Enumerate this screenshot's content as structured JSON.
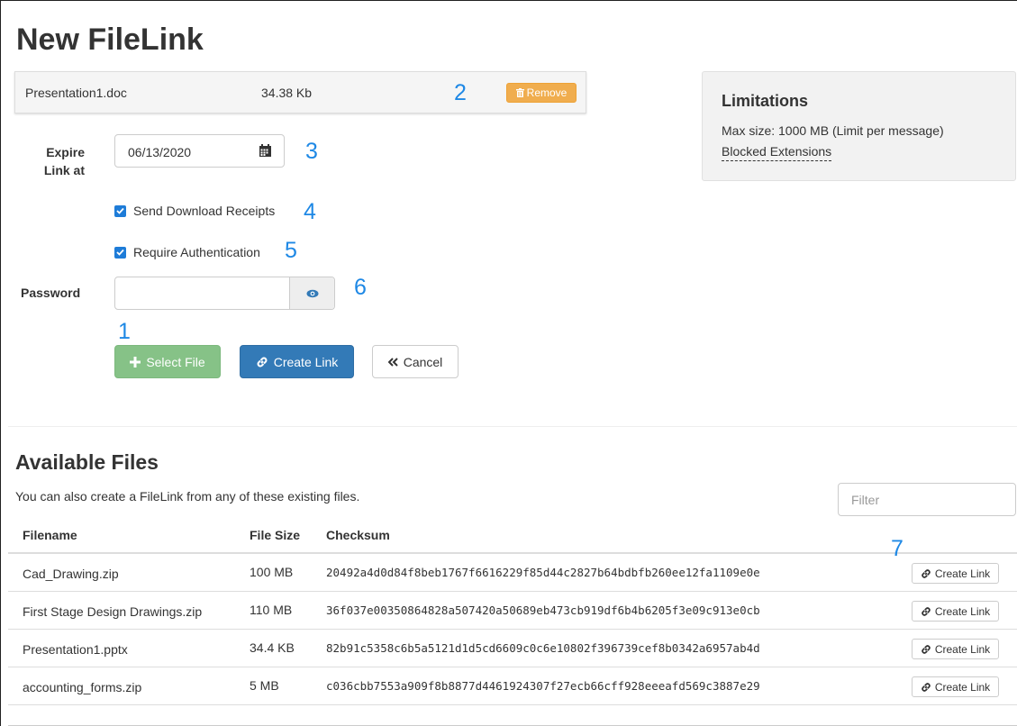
{
  "page": {
    "title": "New FileLink"
  },
  "upload": {
    "filename": "Presentation1.doc",
    "size": "34.38 Kb",
    "remove_label": "Remove"
  },
  "limitations": {
    "title": "Limitations",
    "max_size": "Max size: 1000 MB (Limit per message)",
    "blocked_link": "Blocked Extensions"
  },
  "form": {
    "expire_label_line1": "Expire",
    "expire_label_line2": "Link at",
    "expire_value": "06/13/2020",
    "send_receipts_label": "Send Download Receipts",
    "send_receipts_checked": true,
    "require_auth_label": "Require Authentication",
    "require_auth_checked": true,
    "password_label": "Password",
    "password_value": ""
  },
  "buttons": {
    "select_file": "Select File",
    "create_link": "Create Link",
    "cancel": "Cancel"
  },
  "annotations": {
    "n1": "1",
    "n2": "2",
    "n3": "3",
    "n4": "4",
    "n5": "5",
    "n6": "6",
    "n7": "7"
  },
  "available": {
    "title": "Available Files",
    "subtitle": "You can also create a FileLink from any of these existing files.",
    "filter_placeholder": "Filter",
    "columns": {
      "filename": "Filename",
      "size": "File Size",
      "checksum": "Checksum"
    },
    "row_button": "Create Link",
    "rows": [
      {
        "name": "Cad_Drawing.zip",
        "size": "100 MB",
        "checksum": "20492a4d0d84f8beb1767f6616229f85d44c2827b64bdbfb260ee12fa1109e0e"
      },
      {
        "name": "First Stage Design Drawings.zip",
        "size": "110 MB",
        "checksum": "36f037e00350864828a507420a50689eb473cb919df6b4b6205f3e09c913e0cb"
      },
      {
        "name": "Presentation1.pptx",
        "size": "34.4 KB",
        "checksum": "82b91c5358c6b5a5121d1d5cd6609c0c6e10802f396739cef8b0342a6957ab4d"
      },
      {
        "name": "accounting_forms.zip",
        "size": "5 MB",
        "checksum": "c036cbb7553a909f8b8877d4461924307f27ecb66cff928eeeafd569c3887e29"
      }
    ]
  },
  "colors": {
    "accent": "#337ab7",
    "success": "#86c287",
    "warning": "#f0ad4e",
    "annotation": "#1e88e5"
  }
}
